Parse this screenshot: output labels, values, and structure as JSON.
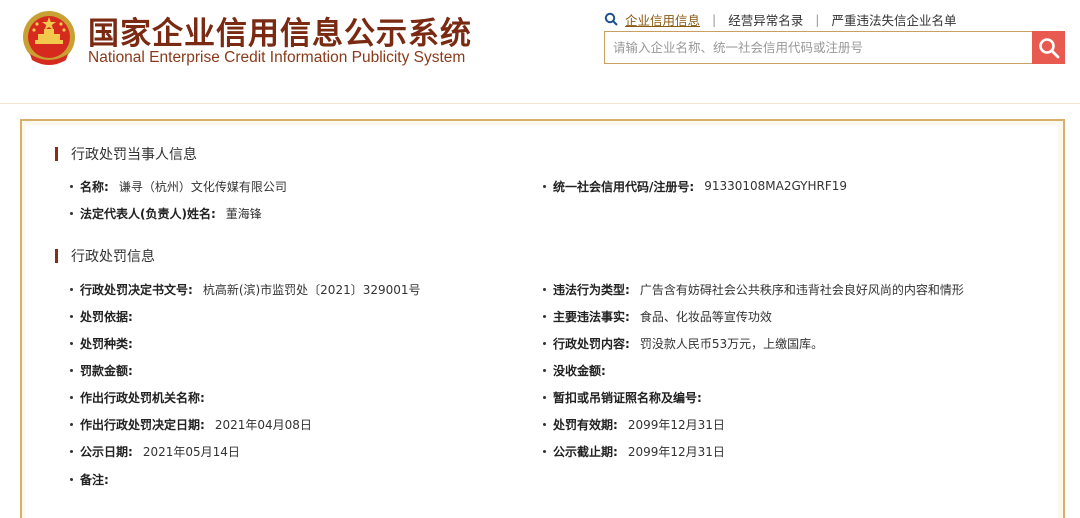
{
  "header": {
    "title_cn": "国家企业信用信息公示系统",
    "title_en": "National Enterprise Credit Information Publicity System",
    "emblem_icon": "national-emblem-icon",
    "nav": {
      "item1": "企业信用信息",
      "item2": "经营异常名录",
      "item3": "严重违法失信企业名单"
    },
    "search": {
      "placeholder": "请输入企业名称、统一社会信用代码或注册号",
      "button_icon": "search-icon"
    }
  },
  "colors": {
    "title": "#7a2a12",
    "accent_gold": "#d8b06a",
    "search_button": "#e85a4f",
    "section_bar": "#8b2d0f"
  },
  "party": {
    "section_title": "行政处罚当事人信息",
    "name_label": "名称:",
    "name_value": "谦寻（杭州）文化传媒有限公司",
    "code_label": "统一社会信用代码/注册号:",
    "code_value": "91330108MA2GYHRF19",
    "rep_label": "法定代表人(负责人)姓名:",
    "rep_value": "董海锋"
  },
  "penalty": {
    "section_title": "行政处罚信息",
    "doc_no_label": "行政处罚决定书文号:",
    "doc_no_value": "杭高新(滨)市监罚处〔2021〕329001号",
    "violation_type_label": "违法行为类型:",
    "violation_type_value": "广告含有妨碍社会公共秩序和违背社会良好风尚的内容和情形",
    "basis_label": "处罚依据:",
    "basis_value": "",
    "main_fact_label": "主要违法事实:",
    "main_fact_value": "食品、化妆品等宣传功效",
    "kind_label": "处罚种类:",
    "kind_value": "",
    "content_label": "行政处罚内容:",
    "content_value": "罚没款人民币53万元，上缴国库。",
    "fine_label": "罚款金额:",
    "fine_value": "",
    "confiscation_label": "没收金额:",
    "confiscation_value": "",
    "authority_label": "作出行政处罚机关名称:",
    "authority_value": "",
    "license_label": "暂扣或吊销证照名称及编号:",
    "license_value": "",
    "decision_date_label": "作出行政处罚决定日期:",
    "decision_date_value": "2021年04月08日",
    "valid_until_label": "处罚有效期:",
    "valid_until_value": "2099年12月31日",
    "publish_date_label": "公示日期:",
    "publish_date_value": "2021年05月14日",
    "publish_end_label": "公示截止期:",
    "publish_end_value": "2099年12月31日",
    "remark_label": "备注:",
    "remark_value": ""
  }
}
